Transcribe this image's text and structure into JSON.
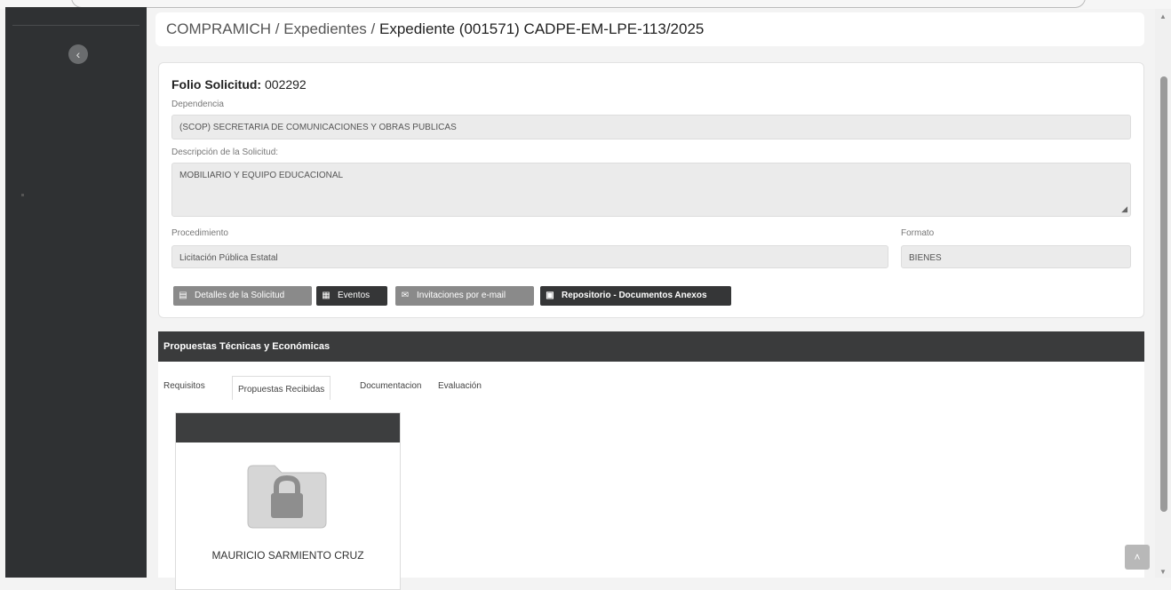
{
  "breadcrumb": {
    "root": "COMPRAMICH",
    "sep1": " / ",
    "section": "Expedientes",
    "sep2": " / ",
    "current": "Expediente (001571) CADPE-EM-LPE-113/2025"
  },
  "request": {
    "folio_label": "Folio Solicitud:",
    "folio_value": "002292",
    "dependencia_label": "Dependencia",
    "dependencia_value": "(SCOP) SECRETARIA DE COMUNICACIONES Y OBRAS PUBLICAS",
    "descripcion_label": "Descripción de la Solicitud:",
    "descripcion_value": "MOBILIARIO Y EQUIPO EDUCACIONAL",
    "procedimiento_label": "Procedimiento",
    "procedimiento_value": "Licitación Pública Estatal",
    "formato_label": "Formato",
    "formato_value": "BIENES"
  },
  "buttons": {
    "detalles": "Detalles de la Solicitud",
    "eventos": "Eventos",
    "invitaciones": "Invitaciones por e-mail",
    "repositorio": "Repositorio - Documentos Anexos"
  },
  "proposals": {
    "title": "Propuestas Técnicas y Económicas",
    "tabs": [
      "Requisitos",
      "Propuestas Recibidas",
      "Documentacion",
      "Evaluación"
    ],
    "active_tab": "Propuestas Recibidas",
    "items": [
      {
        "name": "MAURICIO SARMIENTO CRUZ",
        "icon": "locked-folder-icon"
      }
    ]
  },
  "colors": {
    "sidebar": "#2f3133",
    "panel_header": "#3a3b3c",
    "button_gray": "#8a8a8a",
    "button_dark": "#353637"
  }
}
